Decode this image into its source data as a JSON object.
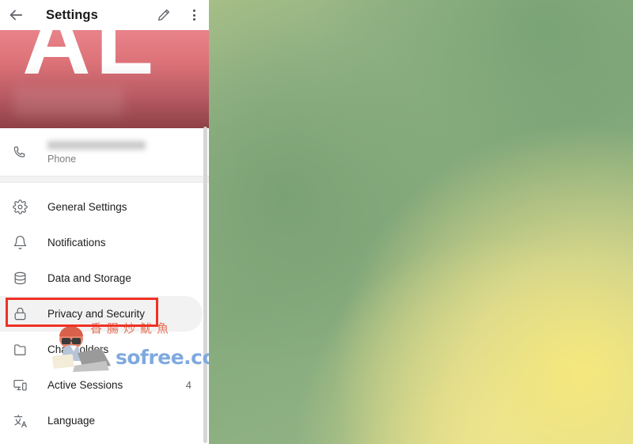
{
  "app": {
    "title": "Settings",
    "back_icon": "arrow-left-icon",
    "edit_icon": "pencil-icon",
    "overflow_icon": "more-vertical-icon"
  },
  "profile": {
    "initials": "AL",
    "name_redacted": true,
    "banner_color_top": "#e8838a",
    "banner_color_bottom": "#8e4046"
  },
  "phone": {
    "icon": "phone-icon",
    "value_redacted": true,
    "label": "Phone"
  },
  "menu": {
    "items": [
      {
        "label": "General Settings",
        "icon": "gear-icon",
        "trailing": "",
        "selected": false
      },
      {
        "label": "Notifications",
        "icon": "bell-icon",
        "trailing": "",
        "selected": false
      },
      {
        "label": "Data and Storage",
        "icon": "database-icon",
        "trailing": "",
        "selected": false
      },
      {
        "label": "Privacy and Security",
        "icon": "lock-icon",
        "trailing": "",
        "selected": true
      },
      {
        "label": "Chat Folders",
        "icon": "folder-icon",
        "trailing": "",
        "selected": false
      },
      {
        "label": "Active Sessions",
        "icon": "devices-icon",
        "trailing": "4",
        "selected": false
      },
      {
        "label": "Language",
        "icon": "translate-icon",
        "trailing": "",
        "selected": false
      }
    ]
  },
  "annotation": {
    "color": "#ef3124",
    "target_label": "Privacy and Security"
  },
  "watermark": {
    "cjk_text": "香腸炒魷魚",
    "site_text": "sofree.cc",
    "cjk_color": "#e2674d",
    "site_color": "#7fa9e0"
  },
  "scrollbar": {
    "name": "vertical-scrollbar"
  }
}
